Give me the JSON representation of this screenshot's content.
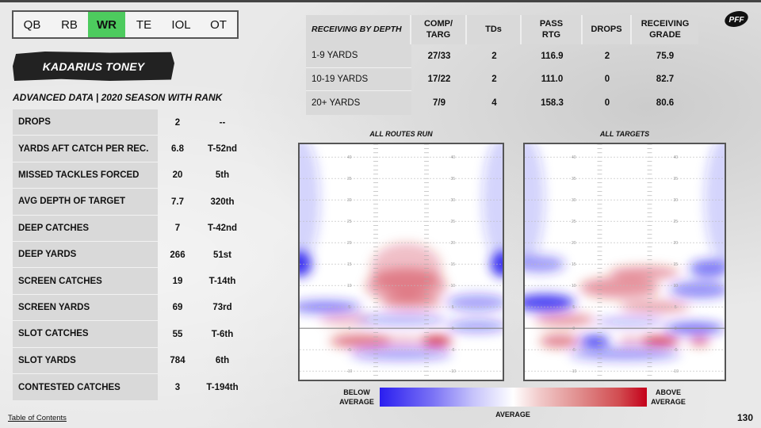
{
  "position_tabs": [
    {
      "label": "QB",
      "active": false
    },
    {
      "label": "RB",
      "active": false
    },
    {
      "label": "WR",
      "active": true
    },
    {
      "label": "TE",
      "active": false
    },
    {
      "label": "IOL",
      "active": false
    },
    {
      "label": "OT",
      "active": false
    }
  ],
  "player_name": "KADARIUS TONEY",
  "section_title": "ADVANCED DATA | 2020 SEASON WITH RANK",
  "advanced_data": [
    {
      "label": "DROPS",
      "value": "2",
      "rank": "--"
    },
    {
      "label": "YARDS AFT CATCH PER REC.",
      "value": "6.8",
      "rank": "T-52nd"
    },
    {
      "label": "MISSED TACKLES FORCED",
      "value": "20",
      "rank": "5th"
    },
    {
      "label": "AVG DEPTH OF TARGET",
      "value": "7.7",
      "rank": "320th"
    },
    {
      "label": "DEEP CATCHES",
      "value": "7",
      "rank": "T-42nd"
    },
    {
      "label": "DEEP YARDS",
      "value": "266",
      "rank": "51st"
    },
    {
      "label": "SCREEN CATCHES",
      "value": "19",
      "rank": "T-14th"
    },
    {
      "label": "SCREEN YARDS",
      "value": "69",
      "rank": "73rd"
    },
    {
      "label": "SLOT CATCHES",
      "value": "55",
      "rank": "T-6th"
    },
    {
      "label": "SLOT YARDS",
      "value": "784",
      "rank": "6th"
    },
    {
      "label": "CONTESTED CATCHES",
      "value": "3",
      "rank": "T-194th"
    }
  ],
  "depth_table": {
    "headers": [
      "RECEIVING BY DEPTH",
      "COMP/\nTARG",
      "TDs",
      "PASS\nRTG",
      "DROPS",
      "RECEIVING\nGRADE"
    ],
    "rows": [
      [
        "1-9 YARDS",
        "27/33",
        "2",
        "116.9",
        "2",
        "75.9"
      ],
      [
        "10-19 YARDS",
        "17/22",
        "2",
        "111.0",
        "0",
        "82.7"
      ],
      [
        "20+ YARDS",
        "7/9",
        "4",
        "158.3",
        "0",
        "80.6"
      ]
    ]
  },
  "logo": "PFF",
  "chart_data": [
    {
      "type": "heatmap",
      "title": "ALL ROUTES RUN",
      "y_labels": [
        "40",
        "35",
        "30",
        "25",
        "20",
        "15",
        "10",
        "5",
        "0",
        "-5",
        "-10"
      ],
      "ylim": [
        -12,
        43
      ],
      "xlim": [
        -1,
        1
      ],
      "blobs": [
        {
          "x": 0.05,
          "y": 14,
          "rx": 0.35,
          "ry": 6,
          "v": 0.25
        },
        {
          "x": 0.05,
          "y": 10,
          "rx": 0.4,
          "ry": 4,
          "v": 0.35
        },
        {
          "x": 0.1,
          "y": 6,
          "rx": 0.3,
          "ry": 2,
          "v": 0.3
        },
        {
          "x": -0.55,
          "y": 2,
          "rx": 0.25,
          "ry": 1.2,
          "v": 0.3
        },
        {
          "x": -0.4,
          "y": -3,
          "rx": 0.3,
          "ry": 1.5,
          "v": 0.55
        },
        {
          "x": 0.35,
          "y": -3,
          "rx": 0.15,
          "ry": 1.2,
          "v": 0.85
        },
        {
          "x": 0.0,
          "y": -3,
          "rx": 0.25,
          "ry": 1,
          "v": 0.3
        },
        {
          "x": -1.0,
          "y": 15,
          "rx": 0.12,
          "ry": 3,
          "v": -0.9
        },
        {
          "x": 1.0,
          "y": 15,
          "rx": 0.12,
          "ry": 3,
          "v": -0.9
        },
        {
          "x": -0.75,
          "y": 5,
          "rx": 0.35,
          "ry": 1.5,
          "v": -0.55
        },
        {
          "x": 0.75,
          "y": 6,
          "rx": 0.3,
          "ry": 2,
          "v": -0.4
        },
        {
          "x": 0.0,
          "y": 2,
          "rx": 0.45,
          "ry": 1.3,
          "v": -0.35
        },
        {
          "x": 0.75,
          "y": 0.5,
          "rx": 0.3,
          "ry": 1.5,
          "v": -0.4
        },
        {
          "x": 0.0,
          "y": -6,
          "rx": 0.5,
          "ry": 1.5,
          "v": -0.4
        },
        {
          "x": -1.0,
          "y": 30,
          "rx": 0.2,
          "ry": 15,
          "v": -0.2
        },
        {
          "x": 1.0,
          "y": 30,
          "rx": 0.2,
          "ry": 15,
          "v": -0.2
        }
      ]
    },
    {
      "type": "heatmap",
      "title": "ALL TARGETS",
      "y_labels": [
        "40",
        "35",
        "30",
        "25",
        "20",
        "15",
        "10",
        "5",
        "0",
        "-5",
        "-10"
      ],
      "ylim": [
        -12,
        43
      ],
      "xlim": [
        -1,
        1
      ],
      "blobs": [
        {
          "x": 0.2,
          "y": 13,
          "rx": 0.35,
          "ry": 1.5,
          "v": 0.4
        },
        {
          "x": -0.05,
          "y": 9.5,
          "rx": 0.4,
          "ry": 2.5,
          "v": 0.4
        },
        {
          "x": 0.3,
          "y": 5,
          "rx": 0.35,
          "ry": 1.5,
          "v": 0.35
        },
        {
          "x": -0.6,
          "y": 2,
          "rx": 0.3,
          "ry": 1.5,
          "v": 0.4
        },
        {
          "x": -0.65,
          "y": -3,
          "rx": 0.2,
          "ry": 1.5,
          "v": 0.5
        },
        {
          "x": 0.35,
          "y": -3,
          "rx": 0.2,
          "ry": 1,
          "v": 0.9
        },
        {
          "x": 0.75,
          "y": -3,
          "rx": 0.1,
          "ry": 1,
          "v": 0.6
        },
        {
          "x": 0.05,
          "y": -3,
          "rx": 0.1,
          "ry": 1,
          "v": 0.35
        },
        {
          "x": -0.3,
          "y": -3,
          "rx": 0.15,
          "ry": 1.2,
          "v": -0.9
        },
        {
          "x": -0.8,
          "y": 6,
          "rx": 0.3,
          "ry": 2,
          "v": -0.85
        },
        {
          "x": 0.75,
          "y": 9,
          "rx": 0.3,
          "ry": 2,
          "v": -0.5
        },
        {
          "x": 0.85,
          "y": 14,
          "rx": 0.2,
          "ry": 2,
          "v": -0.6
        },
        {
          "x": 0.7,
          "y": 0,
          "rx": 0.3,
          "ry": 1.5,
          "v": -0.6
        },
        {
          "x": -0.85,
          "y": 15,
          "rx": 0.25,
          "ry": 2,
          "v": -0.45
        },
        {
          "x": 0.05,
          "y": 1.5,
          "rx": 0.35,
          "ry": 1,
          "v": -0.35
        },
        {
          "x": 0.0,
          "y": -6,
          "rx": 0.55,
          "ry": 1.5,
          "v": -0.45
        },
        {
          "x": -1.0,
          "y": 30,
          "rx": 0.2,
          "ry": 15,
          "v": -0.2
        },
        {
          "x": 1.0,
          "y": 30,
          "rx": 0.2,
          "ry": 15,
          "v": -0.2
        }
      ]
    }
  ],
  "legend": {
    "below": "BELOW\nAVERAGE",
    "average": "AVERAGE",
    "above": "ABOVE\nAVERAGE",
    "low_color": "#2a1ef0",
    "mid_color": "#ffffff",
    "high_color": "#c4001a"
  },
  "footer": {
    "toc_link": "Table of Contents",
    "page_number": "130"
  }
}
